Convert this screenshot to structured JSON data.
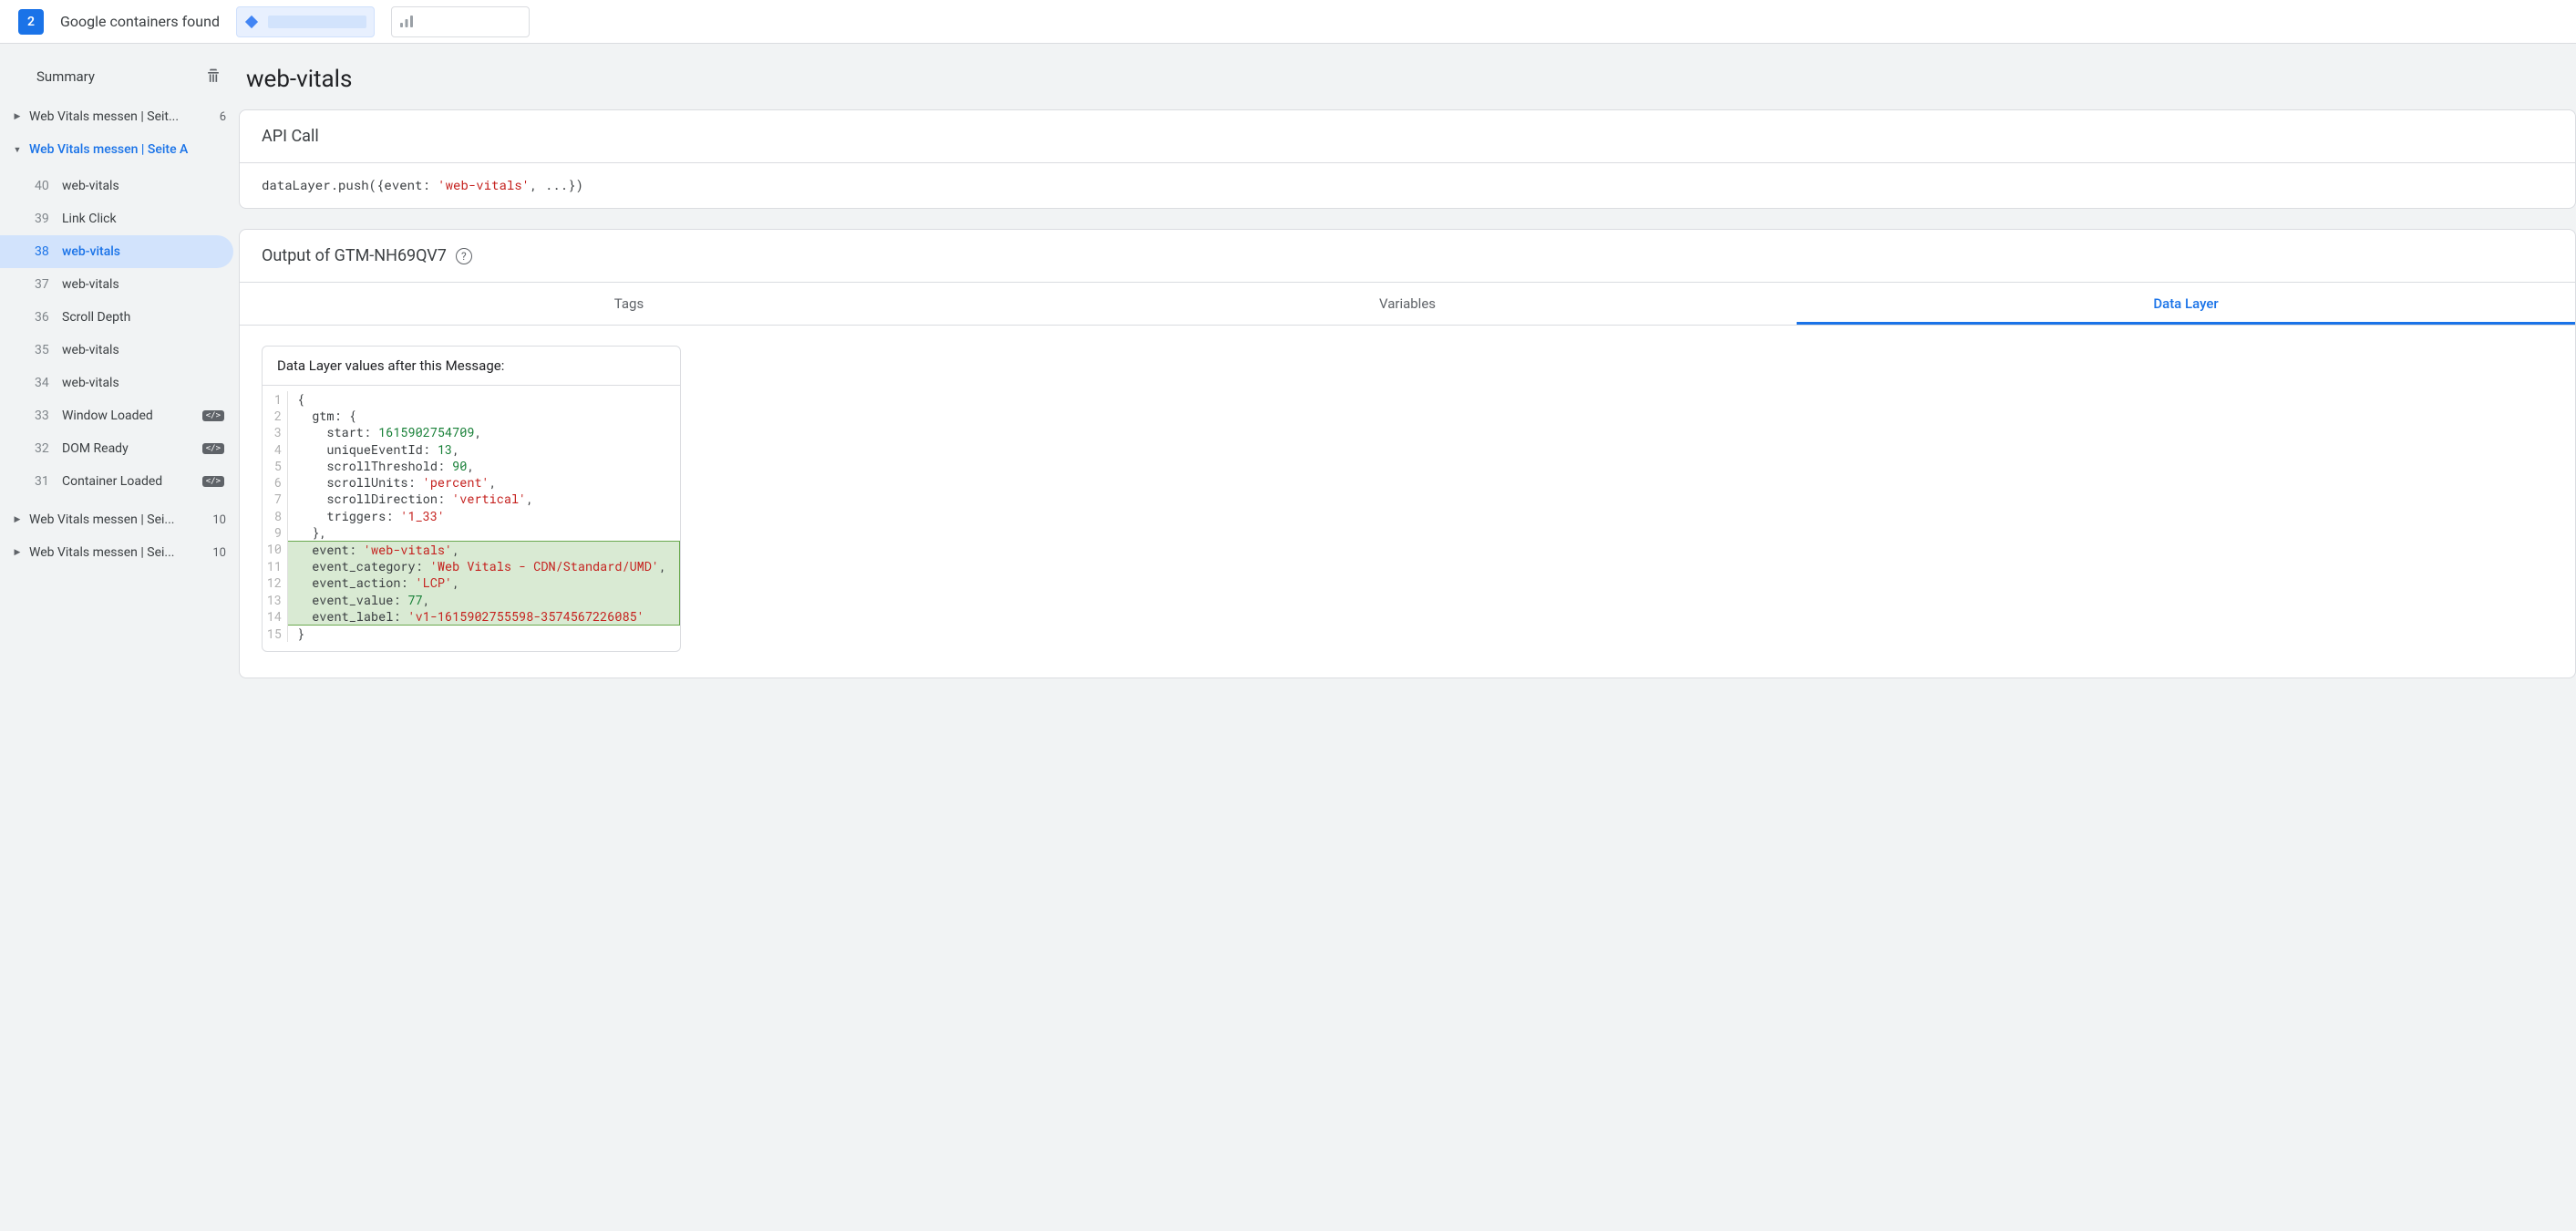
{
  "topbar": {
    "container_count": "2",
    "found_text": "Google containers found"
  },
  "sidebar": {
    "summary_label": "Summary",
    "groups": [
      {
        "label": "Web Vitals messen | Seit...",
        "count": "6",
        "expanded": false,
        "active": false
      },
      {
        "label": "Web Vitals messen | Seite A",
        "count": "",
        "expanded": true,
        "active": true
      },
      {
        "label": "Web Vitals messen | Sei...",
        "count": "10",
        "expanded": false,
        "active": false
      },
      {
        "label": "Web Vitals messen | Sei...",
        "count": "10",
        "expanded": false,
        "active": false
      }
    ],
    "events": [
      {
        "num": "40",
        "name": "web-vitals",
        "chip": false,
        "selected": false
      },
      {
        "num": "39",
        "name": "Link Click",
        "chip": false,
        "selected": false
      },
      {
        "num": "38",
        "name": "web-vitals",
        "chip": false,
        "selected": true
      },
      {
        "num": "37",
        "name": "web-vitals",
        "chip": false,
        "selected": false
      },
      {
        "num": "36",
        "name": "Scroll Depth",
        "chip": false,
        "selected": false
      },
      {
        "num": "35",
        "name": "web-vitals",
        "chip": false,
        "selected": false
      },
      {
        "num": "34",
        "name": "web-vitals",
        "chip": false,
        "selected": false
      },
      {
        "num": "33",
        "name": "Window Loaded",
        "chip": true,
        "selected": false
      },
      {
        "num": "32",
        "name": "DOM Ready",
        "chip": true,
        "selected": false
      },
      {
        "num": "31",
        "name": "Container Loaded",
        "chip": true,
        "selected": false
      }
    ]
  },
  "main": {
    "title": "web-vitals",
    "api_card_title": "API Call",
    "api_call": {
      "prefix": "dataLayer.push({event: ",
      "event_value": "'web-vitals'",
      "suffix": ", ...})"
    },
    "output_card_title": "Output of GTM-NH69QV7",
    "tabs": [
      "Tags",
      "Variables",
      "Data Layer"
    ],
    "active_tab": 2,
    "dl_title": "Data Layer values after this Message:",
    "code_lines": [
      {
        "n": "1",
        "txt": "{",
        "hl": false
      },
      {
        "n": "2",
        "txt": "  gtm: {",
        "hl": false
      },
      {
        "n": "3",
        "txt": "    start: ",
        "num": "1615902754709",
        "tail": ",",
        "hl": false
      },
      {
        "n": "4",
        "txt": "    uniqueEventId: ",
        "num": "13",
        "tail": ",",
        "hl": false
      },
      {
        "n": "5",
        "txt": "    scrollThreshold: ",
        "num": "90",
        "tail": ",",
        "hl": false
      },
      {
        "n": "6",
        "txt": "    scrollUnits: ",
        "str": "'percent'",
        "tail": ",",
        "hl": false
      },
      {
        "n": "7",
        "txt": "    scrollDirection: ",
        "str": "'vertical'",
        "tail": ",",
        "hl": false
      },
      {
        "n": "8",
        "txt": "    triggers: ",
        "str": "'1_33'",
        "tail": "",
        "hl": false
      },
      {
        "n": "9",
        "txt": "  },",
        "hl": false
      },
      {
        "n": "10",
        "txt": "  event: ",
        "str": "'web-vitals'",
        "tail": ",",
        "hl": true,
        "hlpos": "first"
      },
      {
        "n": "11",
        "txt": "  event_category: ",
        "str": "'Web Vitals - CDN/Standard/UMD'",
        "tail": ",",
        "hl": true
      },
      {
        "n": "12",
        "txt": "  event_action: ",
        "str": "'LCP'",
        "tail": ",",
        "hl": true
      },
      {
        "n": "13",
        "txt": "  event_value: ",
        "num": "77",
        "tail": ",",
        "hl": true
      },
      {
        "n": "14",
        "txt": "  event_label: ",
        "str": "'v1-1615902755598-3574567226085'",
        "tail": "",
        "hl": true,
        "hlpos": "last"
      },
      {
        "n": "15",
        "txt": "}",
        "hl": false
      }
    ]
  }
}
